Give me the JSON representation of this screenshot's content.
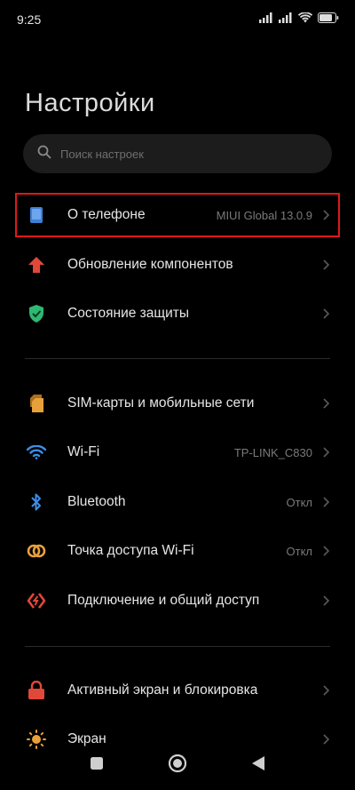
{
  "status": {
    "time": "9:25"
  },
  "title": "Настройки",
  "search": {
    "placeholder": "Поиск настроек",
    "value": ""
  },
  "groups": [
    {
      "items": [
        {
          "label": "О телефоне",
          "value": "MIUI Global 13.0.9",
          "icon": "phone-info-icon",
          "icon_color": "#3d7fd6",
          "highlighted": true
        },
        {
          "label": "Обновление компонентов",
          "value": "",
          "icon": "arrow-up-icon",
          "icon_color": "#e0483a"
        },
        {
          "label": "Состояние защиты",
          "value": "",
          "icon": "shield-check-icon",
          "icon_color": "#2eb872"
        }
      ]
    },
    {
      "items": [
        {
          "label": "SIM-карты и мобильные сети",
          "value": "",
          "icon": "sim-card-icon",
          "icon_color": "#e8a13a"
        },
        {
          "label": "Wi-Fi",
          "value": "TP-LINK_C830",
          "icon": "wifi-icon",
          "icon_color": "#3d8ee8"
        },
        {
          "label": "Bluetooth",
          "value": "Откл",
          "icon": "bluetooth-icon",
          "icon_color": "#3d8ee8"
        },
        {
          "label": "Точка доступа Wi-Fi",
          "value": "Откл",
          "icon": "hotspot-icon",
          "icon_color": "#e8a13a"
        },
        {
          "label": "Подключение и общий доступ",
          "value": "",
          "icon": "share-connection-icon",
          "icon_color": "#e0483a"
        }
      ]
    },
    {
      "items": [
        {
          "label": "Активный экран и блокировка",
          "value": "",
          "icon": "lock-icon",
          "icon_color": "#e0483a"
        },
        {
          "label": "Экран",
          "value": "",
          "icon": "brightness-icon",
          "icon_color": "#e8a13a"
        }
      ]
    }
  ],
  "colors": {
    "background": "#000000",
    "highlight_border": "#e01818"
  }
}
